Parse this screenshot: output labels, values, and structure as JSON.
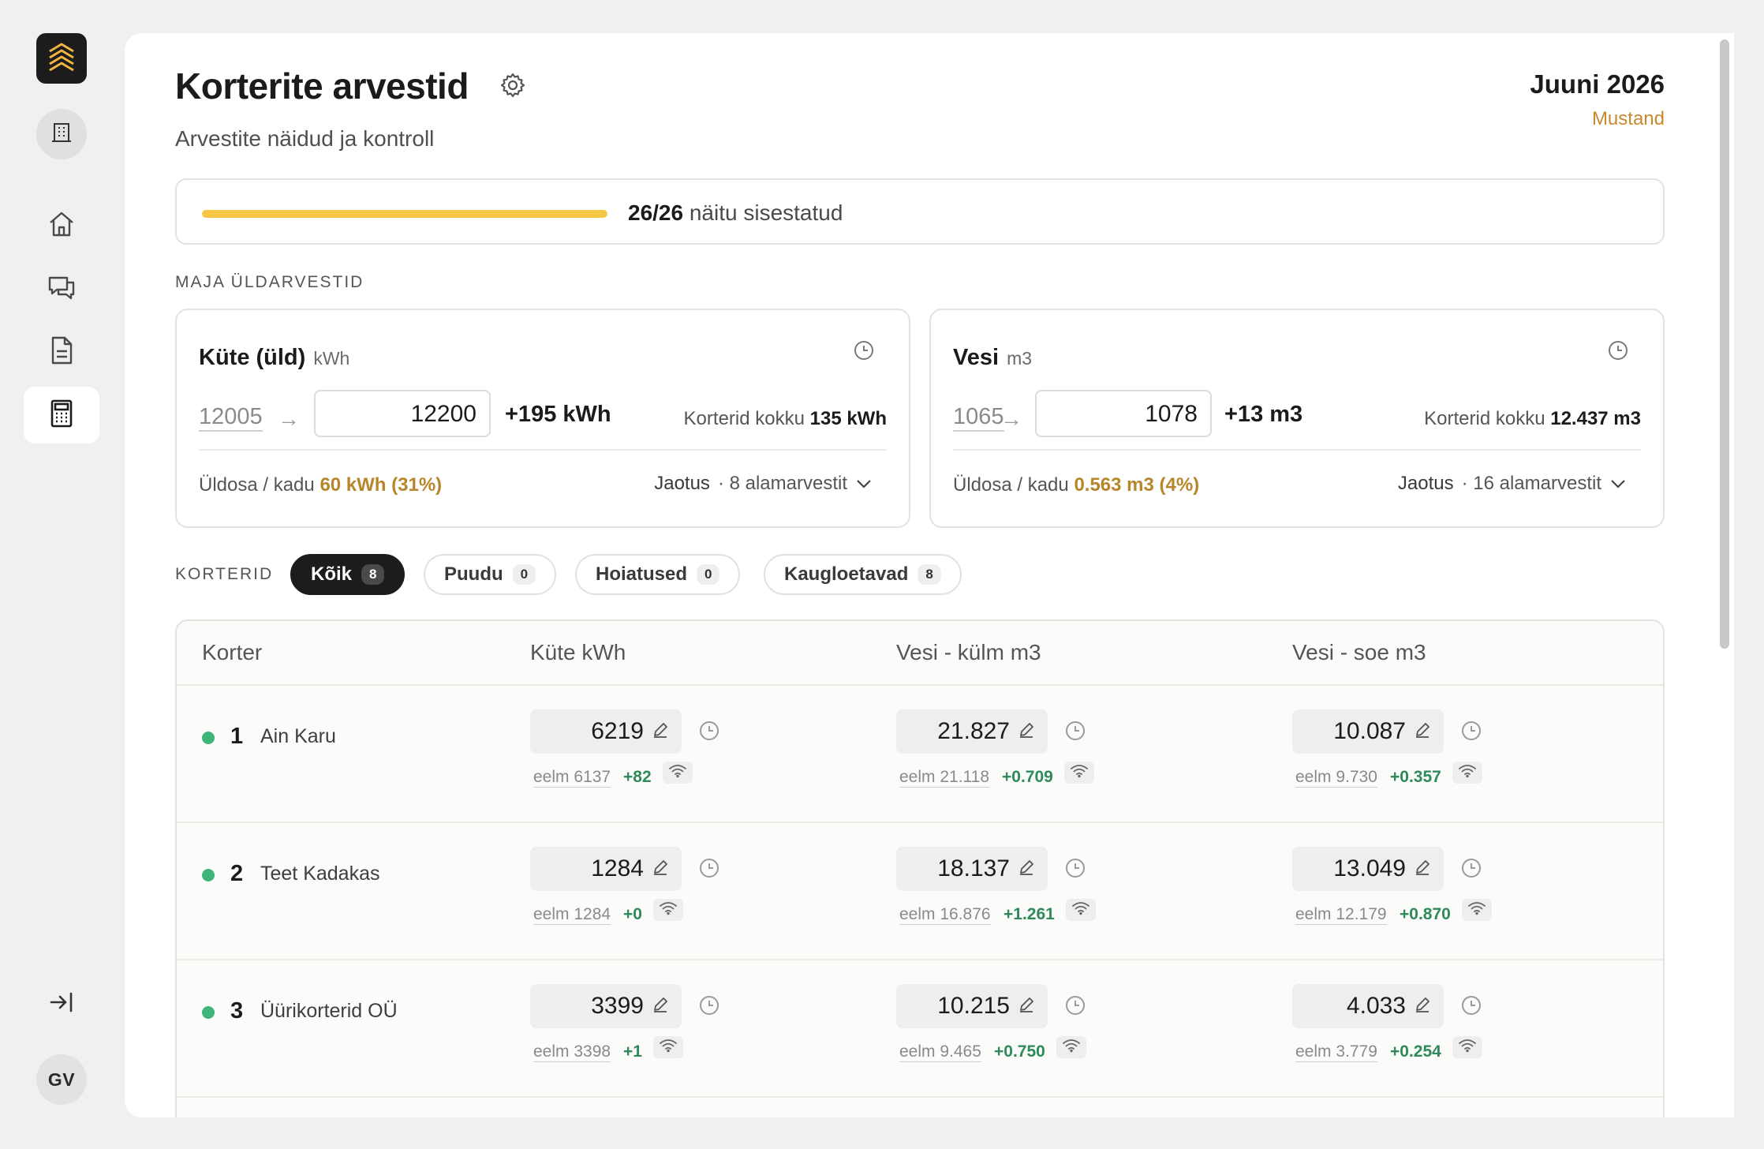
{
  "app": {
    "title": "Korterite arvestid",
    "subtitle": "Arvestite näidud ja kontroll",
    "period": "Juuni 2026",
    "status": "Mustand",
    "user_initials": "GV"
  },
  "progress": {
    "count": "26/26",
    "label": "näitu sisestatud",
    "fraction": 1.0,
    "color": "#f6c744"
  },
  "sections": {
    "building_meters": "MAJA ÜLDARVESTID",
    "apartments": "KORTERID"
  },
  "meters": [
    {
      "title": "Küte (üld)",
      "unit": "kWh",
      "previous": "12005",
      "current": "12200",
      "delta": "+195 kWh",
      "total_label": "Korterid kokku",
      "total_value": "135 kWh",
      "loss_label": "Üldosa / kadu",
      "loss_value": "60 kWh (31%)",
      "split_label": "Jaotus",
      "split_count": "· 8 alamarvestit"
    },
    {
      "title": "Vesi",
      "unit": "m3",
      "previous": "1065",
      "current": "1078",
      "delta": "+13 m3",
      "total_label": "Korterid kokku",
      "total_value": "12.437 m3",
      "loss_label": "Üldosa / kadu",
      "loss_value": "0.563 m3 (4%)",
      "split_label": "Jaotus",
      "split_count": "· 16 alamarvestit"
    }
  ],
  "filters": [
    {
      "label": "Kõik",
      "count": "8",
      "active": true
    },
    {
      "label": "Puudu",
      "count": "0",
      "active": false
    },
    {
      "label": "Hoiatused",
      "count": "0",
      "active": false
    },
    {
      "label": "Kaugloetavad",
      "count": "8",
      "active": false
    }
  ],
  "table": {
    "columns": [
      "Korter",
      "Küte kWh",
      "Vesi - külm m3",
      "Vesi - soe m3"
    ],
    "rows": [
      {
        "number": "1",
        "name": "Ain Karu",
        "heat": {
          "value": "6219",
          "prev": "eelm 6137",
          "delta": "+82"
        },
        "cold": {
          "value": "21.827",
          "prev": "eelm 21.118",
          "delta": "+0.709"
        },
        "hot": {
          "value": "10.087",
          "prev": "eelm 9.730",
          "delta": "+0.357"
        }
      },
      {
        "number": "2",
        "name": "Teet Kadakas",
        "heat": {
          "value": "1284",
          "prev": "eelm 1284",
          "delta": "+0"
        },
        "cold": {
          "value": "18.137",
          "prev": "eelm 16.876",
          "delta": "+1.261"
        },
        "hot": {
          "value": "13.049",
          "prev": "eelm 12.179",
          "delta": "+0.870"
        }
      },
      {
        "number": "3",
        "name": "Üürikorterid OÜ",
        "heat": {
          "value": "3399",
          "prev": "eelm 3398",
          "delta": "+1"
        },
        "cold": {
          "value": "10.215",
          "prev": "eelm 9.465",
          "delta": "+0.750"
        },
        "hot": {
          "value": "4.033",
          "prev": "eelm 3.779",
          "delta": "+0.254"
        }
      }
    ]
  },
  "colors": {
    "accent_progress": "#f6c744",
    "status": "#c8892b",
    "loss": "#b8862a",
    "delta_positive": "#2f8a5a",
    "status_dot": "#3fb57a"
  },
  "icons": {
    "logo": "building-stack-logo-icon",
    "building": "building-icon",
    "home": "home-icon",
    "chat": "chat-icon",
    "document": "document-icon",
    "calculator": "calculator-icon",
    "collapse": "collapse-sidebar-icon",
    "settings": "gear-icon",
    "history": "clock-icon",
    "edit": "edit-icon",
    "remote": "wifi-icon",
    "chevron": "chevron-down-icon",
    "arrow": "arrow-right-icon"
  }
}
